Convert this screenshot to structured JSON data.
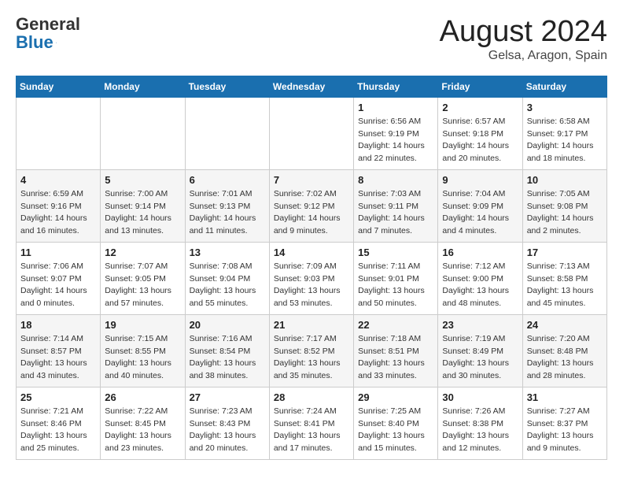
{
  "header": {
    "logo_general": "General",
    "logo_blue": "Blue",
    "month_year": "August 2024",
    "location": "Gelsa, Aragon, Spain"
  },
  "weekdays": [
    "Sunday",
    "Monday",
    "Tuesday",
    "Wednesday",
    "Thursday",
    "Friday",
    "Saturday"
  ],
  "weeks": [
    [
      {
        "day": "",
        "info": ""
      },
      {
        "day": "",
        "info": ""
      },
      {
        "day": "",
        "info": ""
      },
      {
        "day": "",
        "info": ""
      },
      {
        "day": "1",
        "info": "Sunrise: 6:56 AM\nSunset: 9:19 PM\nDaylight: 14 hours\nand 22 minutes."
      },
      {
        "day": "2",
        "info": "Sunrise: 6:57 AM\nSunset: 9:18 PM\nDaylight: 14 hours\nand 20 minutes."
      },
      {
        "day": "3",
        "info": "Sunrise: 6:58 AM\nSunset: 9:17 PM\nDaylight: 14 hours\nand 18 minutes."
      }
    ],
    [
      {
        "day": "4",
        "info": "Sunrise: 6:59 AM\nSunset: 9:16 PM\nDaylight: 14 hours\nand 16 minutes."
      },
      {
        "day": "5",
        "info": "Sunrise: 7:00 AM\nSunset: 9:14 PM\nDaylight: 14 hours\nand 13 minutes."
      },
      {
        "day": "6",
        "info": "Sunrise: 7:01 AM\nSunset: 9:13 PM\nDaylight: 14 hours\nand 11 minutes."
      },
      {
        "day": "7",
        "info": "Sunrise: 7:02 AM\nSunset: 9:12 PM\nDaylight: 14 hours\nand 9 minutes."
      },
      {
        "day": "8",
        "info": "Sunrise: 7:03 AM\nSunset: 9:11 PM\nDaylight: 14 hours\nand 7 minutes."
      },
      {
        "day": "9",
        "info": "Sunrise: 7:04 AM\nSunset: 9:09 PM\nDaylight: 14 hours\nand 4 minutes."
      },
      {
        "day": "10",
        "info": "Sunrise: 7:05 AM\nSunset: 9:08 PM\nDaylight: 14 hours\nand 2 minutes."
      }
    ],
    [
      {
        "day": "11",
        "info": "Sunrise: 7:06 AM\nSunset: 9:07 PM\nDaylight: 14 hours\nand 0 minutes."
      },
      {
        "day": "12",
        "info": "Sunrise: 7:07 AM\nSunset: 9:05 PM\nDaylight: 13 hours\nand 57 minutes."
      },
      {
        "day": "13",
        "info": "Sunrise: 7:08 AM\nSunset: 9:04 PM\nDaylight: 13 hours\nand 55 minutes."
      },
      {
        "day": "14",
        "info": "Sunrise: 7:09 AM\nSunset: 9:03 PM\nDaylight: 13 hours\nand 53 minutes."
      },
      {
        "day": "15",
        "info": "Sunrise: 7:11 AM\nSunset: 9:01 PM\nDaylight: 13 hours\nand 50 minutes."
      },
      {
        "day": "16",
        "info": "Sunrise: 7:12 AM\nSunset: 9:00 PM\nDaylight: 13 hours\nand 48 minutes."
      },
      {
        "day": "17",
        "info": "Sunrise: 7:13 AM\nSunset: 8:58 PM\nDaylight: 13 hours\nand 45 minutes."
      }
    ],
    [
      {
        "day": "18",
        "info": "Sunrise: 7:14 AM\nSunset: 8:57 PM\nDaylight: 13 hours\nand 43 minutes."
      },
      {
        "day": "19",
        "info": "Sunrise: 7:15 AM\nSunset: 8:55 PM\nDaylight: 13 hours\nand 40 minutes."
      },
      {
        "day": "20",
        "info": "Sunrise: 7:16 AM\nSunset: 8:54 PM\nDaylight: 13 hours\nand 38 minutes."
      },
      {
        "day": "21",
        "info": "Sunrise: 7:17 AM\nSunset: 8:52 PM\nDaylight: 13 hours\nand 35 minutes."
      },
      {
        "day": "22",
        "info": "Sunrise: 7:18 AM\nSunset: 8:51 PM\nDaylight: 13 hours\nand 33 minutes."
      },
      {
        "day": "23",
        "info": "Sunrise: 7:19 AM\nSunset: 8:49 PM\nDaylight: 13 hours\nand 30 minutes."
      },
      {
        "day": "24",
        "info": "Sunrise: 7:20 AM\nSunset: 8:48 PM\nDaylight: 13 hours\nand 28 minutes."
      }
    ],
    [
      {
        "day": "25",
        "info": "Sunrise: 7:21 AM\nSunset: 8:46 PM\nDaylight: 13 hours\nand 25 minutes."
      },
      {
        "day": "26",
        "info": "Sunrise: 7:22 AM\nSunset: 8:45 PM\nDaylight: 13 hours\nand 23 minutes."
      },
      {
        "day": "27",
        "info": "Sunrise: 7:23 AM\nSunset: 8:43 PM\nDaylight: 13 hours\nand 20 minutes."
      },
      {
        "day": "28",
        "info": "Sunrise: 7:24 AM\nSunset: 8:41 PM\nDaylight: 13 hours\nand 17 minutes."
      },
      {
        "day": "29",
        "info": "Sunrise: 7:25 AM\nSunset: 8:40 PM\nDaylight: 13 hours\nand 15 minutes."
      },
      {
        "day": "30",
        "info": "Sunrise: 7:26 AM\nSunset: 8:38 PM\nDaylight: 13 hours\nand 12 minutes."
      },
      {
        "day": "31",
        "info": "Sunrise: 7:27 AM\nSunset: 8:37 PM\nDaylight: 13 hours\nand 9 minutes."
      }
    ]
  ]
}
